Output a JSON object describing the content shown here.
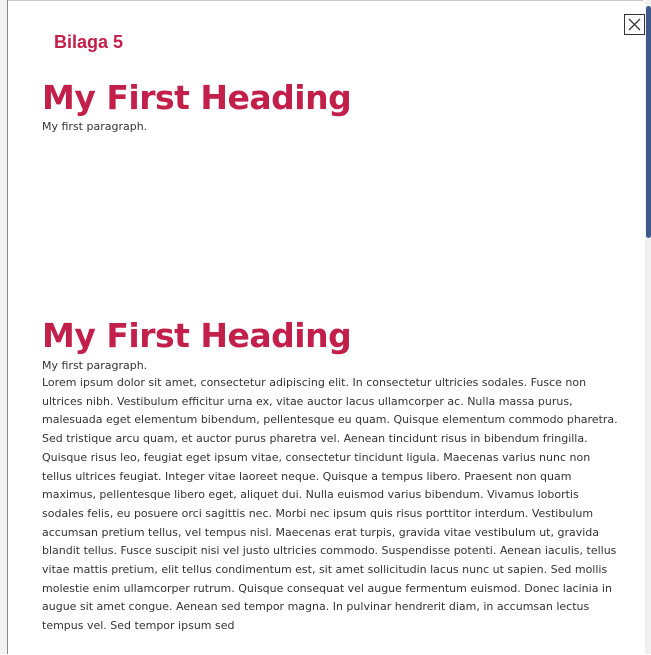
{
  "modal": {
    "label": "Bilaga 5",
    "close_icon": "close-icon",
    "sections": [
      {
        "heading": "My First Heading",
        "paragraph": "My first paragraph."
      },
      {
        "heading": "My First Heading",
        "paragraph": "My first paragraph."
      }
    ],
    "lorem": "Lorem ipsum dolor sit amet, consectetur adipiscing elit. In consectetur ultricies sodales. Fusce non ultrices nibh. Vestibulum efficitur urna ex, vitae auctor lacus ullamcorper ac. Nulla massa purus, malesuada eget elementum bibendum, pellentesque eu quam. Quisque elementum commodo pharetra. Sed tristique arcu quam, et auctor purus pharetra vel. Aenean tincidunt risus in bibendum fringilla. Quisque risus leo, feugiat eget ipsum vitae, consectetur tincidunt ligula. Maecenas varius nunc non tellus ultrices feugiat. Integer vitae laoreet neque. Quisque a tempus libero. Praesent non quam maximus, pellentesque libero eget, aliquet dui. Nulla euismod varius bibendum. Vivamus lobortis sodales felis, eu posuere orci sagittis nec. Morbi nec ipsum quis risus porttitor interdum. Vestibulum accumsan pretium tellus, vel tempus nisl. Maecenas erat turpis, gravida vitae vestibulum ut, gravida blandit tellus. Fusce suscipit nisi vel justo ultricies commodo. Suspendisse potenti. Aenean iaculis, tellus vitae mattis pretium, elit tellus condimentum est, sit amet sollicitudin lacus nunc ut sapien. Sed mollis molestie enim ullamcorper rutrum. Quisque consequat vel augue fermentum euismod. Donec lacinia in augue sit amet congue. Aenean sed tempor magna. In pulvinar hendrerit diam, in accumsan lectus tempus vel. Sed tempor ipsum sed"
  },
  "colors": {
    "accent": "#c21f4a",
    "scrollbar_thumb": "#3d5a8a"
  }
}
